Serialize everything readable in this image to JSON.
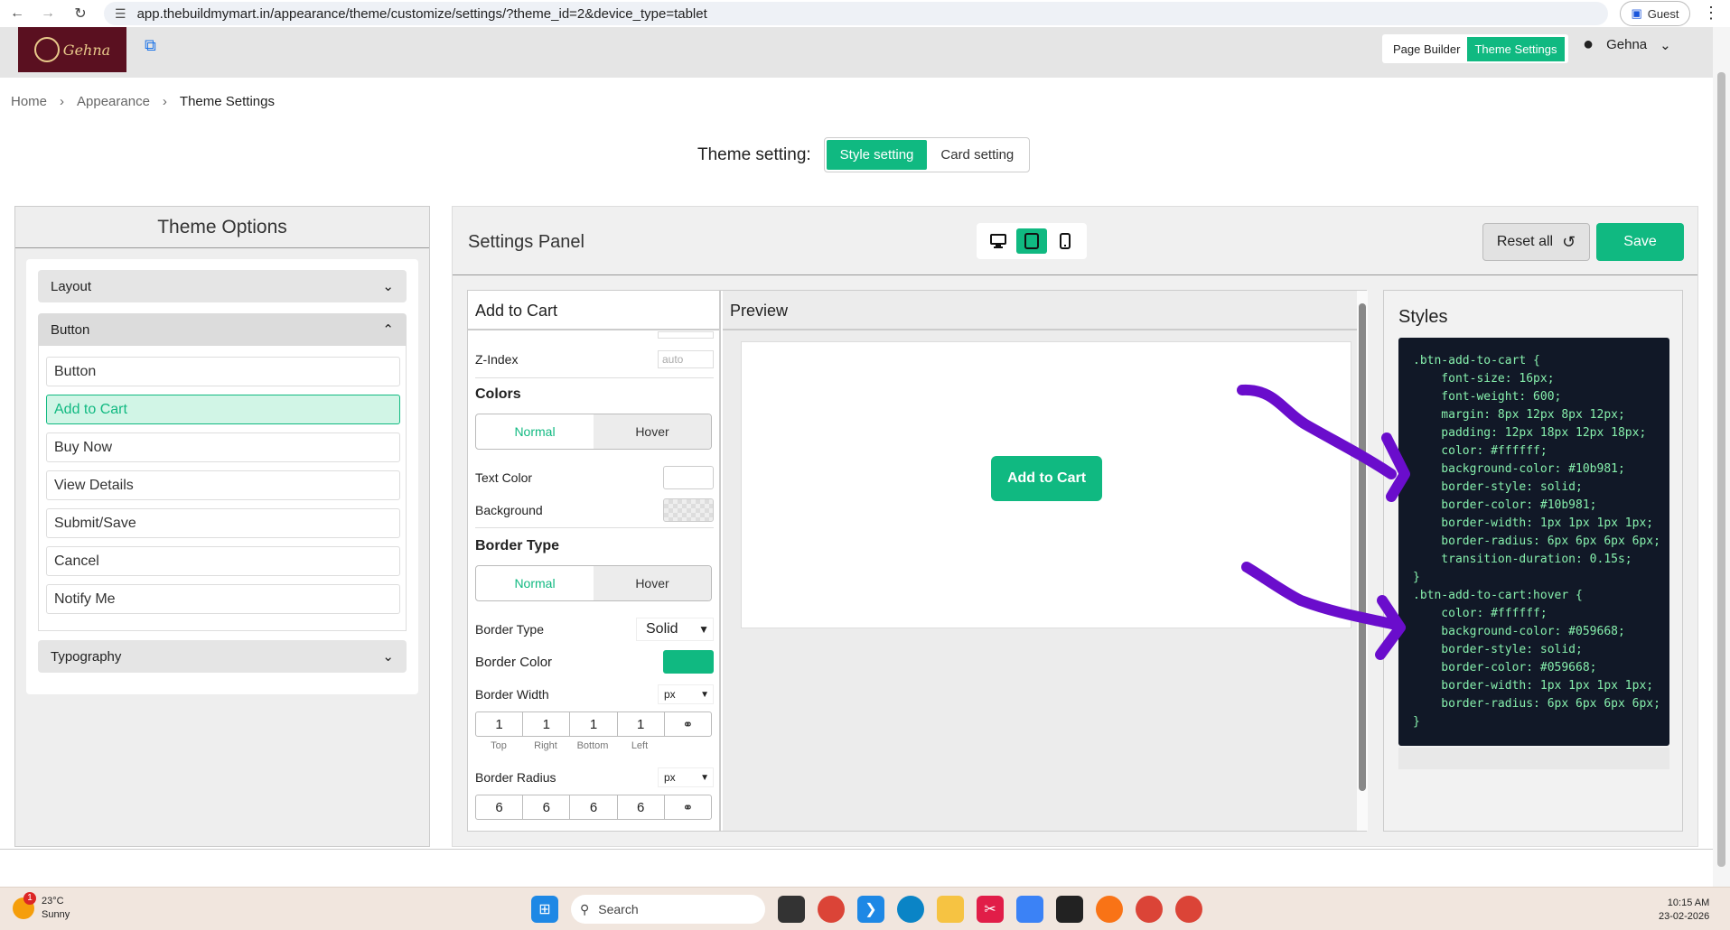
{
  "browser": {
    "url": "app.thebuildmymart.in/appearance/theme/customize/settings/?theme_id=2&device_type=tablet",
    "profile": "Guest"
  },
  "header": {
    "brand": "Gehna",
    "tabs": [
      "Page Builder",
      "Theme Settings"
    ],
    "user": "Gehna"
  },
  "breadcrumb": [
    "Home",
    "Appearance",
    "Theme Settings"
  ],
  "theme_setting": {
    "label": "Theme setting:",
    "options": [
      "Style setting",
      "Card setting"
    ]
  },
  "theme_options": {
    "title": "Theme Options",
    "sections": [
      "Layout",
      "Button",
      "Typography"
    ],
    "button_items": [
      "Button",
      "Add to Cart",
      "Buy Now",
      "View Details",
      "Submit/Save",
      "Cancel",
      "Notify Me"
    ]
  },
  "settings_panel": {
    "title": "Settings Panel",
    "reset_label": "Reset all",
    "save_label": "Save"
  },
  "editor": {
    "title": "Add to Cart",
    "zindex_label": "Z-Index",
    "zindex_placeholder": "auto",
    "colors_title": "Colors",
    "toggle_normal": "Normal",
    "toggle_hover": "Hover",
    "text_color_label": "Text Color",
    "background_label": "Background",
    "border_type_title": "Border Type",
    "border_type_label": "Border Type",
    "border_type_value": "Solid",
    "border_color_label": "Border Color",
    "border_color_value": "#10b981",
    "border_width_label": "Border Width",
    "border_width_unit": "px",
    "border_width_values": [
      "1",
      "1",
      "1",
      "1"
    ],
    "side_labels": [
      "Top",
      "Right",
      "Bottom",
      "Left"
    ],
    "border_radius_label": "Border Radius",
    "border_radius_unit": "px",
    "border_radius_values": [
      "6",
      "6",
      "6",
      "6"
    ]
  },
  "preview": {
    "title": "Preview",
    "button_label": "Add to Cart"
  },
  "styles": {
    "title": "Styles",
    "code": ".btn-add-to-cart {\n    font-size: 16px;\n    font-weight: 600;\n    margin: 8px 12px 8px 12px;\n    padding: 12px 18px 12px 18px;\n    color: #ffffff;\n    background-color: #10b981;\n    border-style: solid;\n    border-color: #10b981;\n    border-width: 1px 1px 1px 1px;\n    border-radius: 6px 6px 6px 6px;\n    transition-duration: 0.15s;\n}\n.btn-add-to-cart:hover {\n    color: #ffffff;\n    background-color: #059668;\n    border-style: solid;\n    border-color: #059668;\n    border-width: 1px 1px 1px 1px;\n    border-radius: 6px 6px 6px 6px;\n}"
  },
  "taskbar": {
    "temp": "23°C",
    "weather": "Sunny",
    "weather_badge": "1",
    "search_placeholder": "Search",
    "time": "10:15 AM",
    "date": "23-02-2026"
  },
  "colors": {
    "accent": "#10b981",
    "annotation": "#6a0dcc",
    "code_bg": "#111827"
  }
}
